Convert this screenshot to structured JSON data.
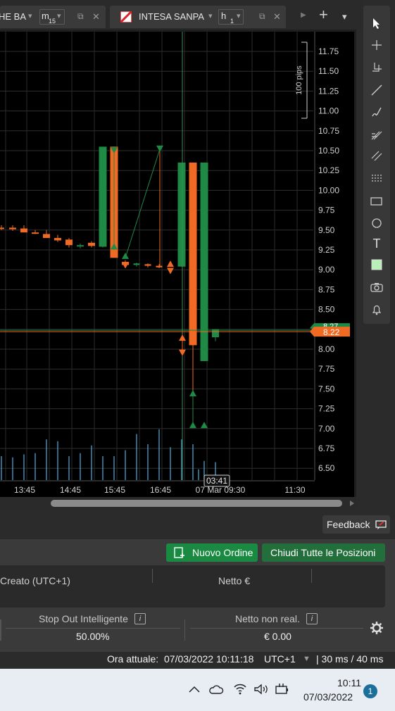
{
  "tabs": [
    {
      "label": "HE BA",
      "timeframe": "m",
      "timeframe_sub": "15"
    },
    {
      "label": "INTESA SANPA",
      "timeframe": "h",
      "timeframe_sub": "1"
    }
  ],
  "tab_icons": {
    "dropdown": "▾",
    "popout": "⧉",
    "play": "▶",
    "add": "+",
    "menu": "▾"
  },
  "chart": {
    "pips_label": "100 pips",
    "current_price_top": "8.27",
    "current_price": "8.22",
    "cursor_time": "03:41"
  },
  "chart_data": {
    "type": "candlestick",
    "y_ticks": [
      "11.75",
      "11.50",
      "11.25",
      "11.00",
      "10.75",
      "10.50",
      "10.25",
      "10.00",
      "9.75",
      "9.50",
      "9.25",
      "9.00",
      "8.75",
      "8.50",
      "8.25",
      "8.00",
      "7.75",
      "7.50",
      "7.25",
      "7.00",
      "6.75",
      "6.50"
    ],
    "x_ticks": [
      "13:45",
      "14:45",
      "15:45",
      "16:45",
      "07 Mar 09:30",
      "11:30"
    ],
    "ylim": [
      6.35,
      11.85
    ],
    "colors": {
      "up": "#1e8a45",
      "down": "#f06a24",
      "volume": "#4aa3d6",
      "price_line": "#f06a24"
    }
  },
  "toolbar": [
    {
      "icon": "cursor-icon"
    },
    {
      "icon": "crosshair-icon"
    },
    {
      "icon": "measure-icon"
    },
    {
      "icon": "trendline-icon"
    },
    {
      "icon": "brush-icon"
    },
    {
      "icon": "fibonacci-icon"
    },
    {
      "icon": "channel-icon"
    },
    {
      "icon": "levels-icon"
    },
    {
      "icon": "rectangle-icon"
    },
    {
      "icon": "ellipse-icon"
    },
    {
      "icon": "text-icon"
    },
    {
      "icon": "color-swatch-icon"
    },
    {
      "icon": "camera-icon"
    },
    {
      "icon": "bell-icon"
    }
  ],
  "feedback_label": "Feedback",
  "buttons": {
    "new_order": "Nuovo Ordine",
    "close_all": "Chiudi Tutte le Posizioni"
  },
  "table": {
    "col_created": "Creato (UTC+1)",
    "col_net": "Netto €"
  },
  "summary": {
    "stop_out_label": "Stop Out Intelligente",
    "stop_out_value": "50.00%",
    "unrealized_label": "Netto non real.",
    "unrealized_value": "€ 0.00",
    "info_glyph": "i"
  },
  "status": {
    "time_label": "Ora attuale:",
    "time_value": "07/03/2022 10:11:18",
    "tz": "UTC+1",
    "latency": "| 30 ms / 40 ms"
  },
  "taskbar": {
    "time": "10:11",
    "date": "07/03/2022",
    "badge": "1"
  }
}
